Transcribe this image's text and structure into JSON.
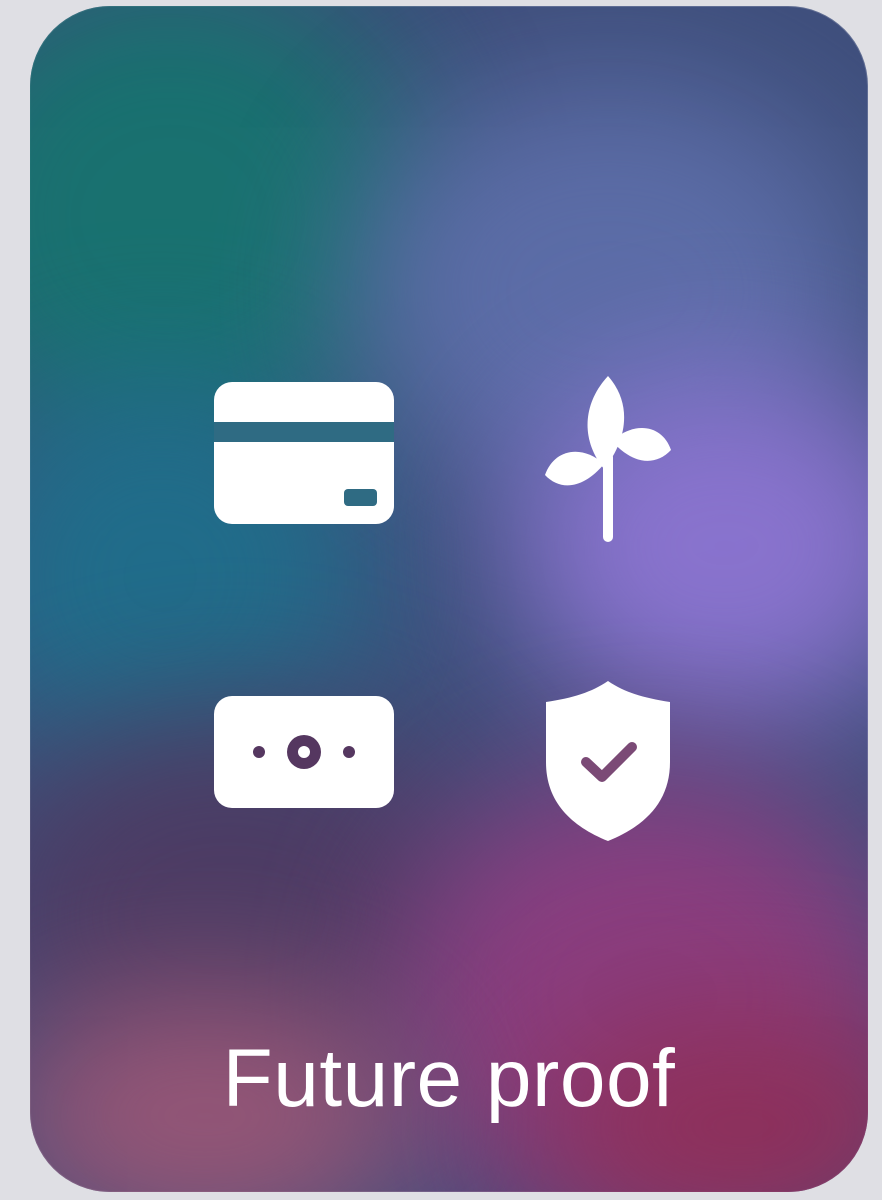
{
  "card": {
    "title": "Future proof",
    "icons": [
      {
        "name": "credit-card-icon"
      },
      {
        "name": "sprout-icon"
      },
      {
        "name": "banknote-icon"
      },
      {
        "name": "shield-check-icon"
      }
    ],
    "colors": {
      "page_background": "#dfdfe4",
      "icon_fill": "#ffffff",
      "card_icon_accent": "#2f6b83",
      "banknote_icon_accent": "#553760",
      "shield_icon_accent": "#7b4a76"
    }
  }
}
